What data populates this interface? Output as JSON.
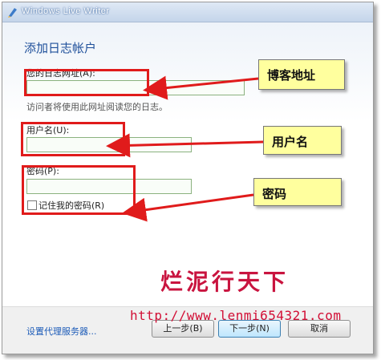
{
  "window": {
    "title": "Windows Live Writer"
  },
  "dialog": {
    "heading": "添加日志帐户",
    "blog_url": {
      "label": "您的日志网址(A):",
      "value": "",
      "hint": "访问者将使用此网址阅读您的日志。"
    },
    "username": {
      "label": "用户名(U):",
      "value": ""
    },
    "password": {
      "label": "密码(P):",
      "value": ""
    },
    "remember": {
      "label": "记住我的密码(R)",
      "checked": false
    }
  },
  "footer": {
    "proxy_link": "设置代理服务器...",
    "back_label": "上一步(B)",
    "next_label": "下一步(N)",
    "cancel_label": "取消"
  },
  "annotations": {
    "callout_blog_url": "博客地址",
    "callout_username": "用户名",
    "callout_password": "密码"
  },
  "watermark": {
    "title": "烂泥行天下",
    "url": "http://www.lenmi654321.com"
  },
  "colors": {
    "annotation_red": "#e01b1b",
    "callout_bg": "#ffff9e",
    "heading_blue": "#1e4f9a"
  }
}
